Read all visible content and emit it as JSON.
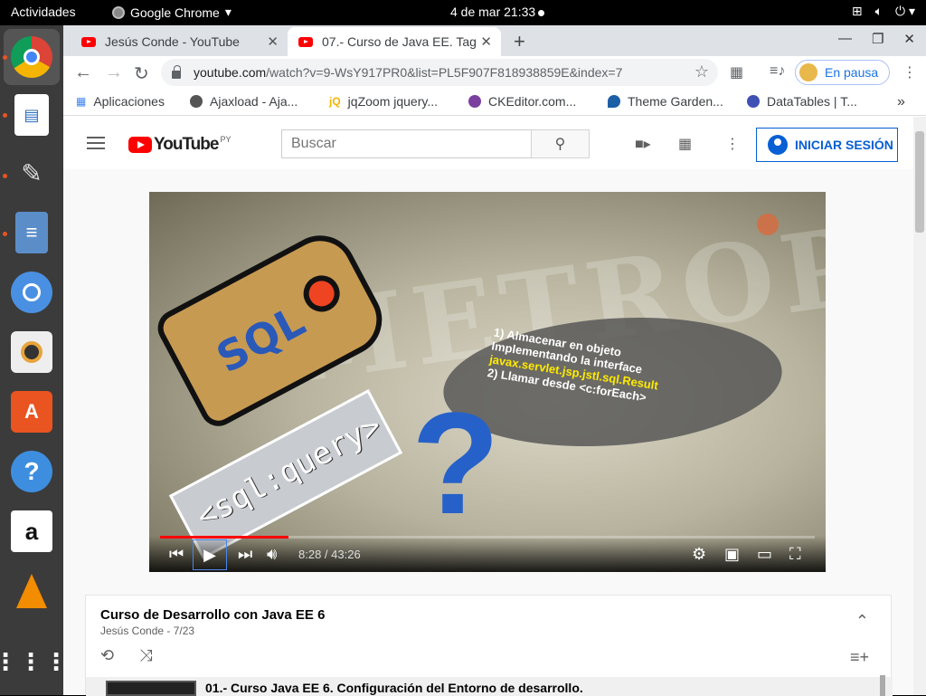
{
  "system": {
    "activities": "Actividades",
    "app_name": "Google Chrome",
    "clock": "4 de mar  21:33"
  },
  "tabs": [
    {
      "title": "Jesús Conde - YouTube",
      "active": false
    },
    {
      "title": "07.- Curso de Java EE. Tag",
      "active": true
    }
  ],
  "address_bar": {
    "host": "youtube.com",
    "path": "/watch?v=9-WsY917PR0&list=PL5F907F818938859E&index=7"
  },
  "profile": {
    "label": "En pausa"
  },
  "bookmarks": [
    {
      "label": "Aplicaciones",
      "color": "#4285f4"
    },
    {
      "label": "Ajaxload - Aja...",
      "color": "#555555"
    },
    {
      "label": "jqZoom jquery...",
      "color": "#f4b400"
    },
    {
      "label": "CKEditor.com...",
      "color": "#7b3fa0"
    },
    {
      "label": "Theme Garden...",
      "color": "#1c5fa6"
    },
    {
      "label": "DataTables | T...",
      "color": "#3f51b5"
    }
  ],
  "youtube": {
    "logo_text": "YouTube",
    "country": "PY",
    "search_placeholder": "Buscar",
    "signin_label": "INICIAR SESIÓN"
  },
  "video": {
    "slide_title": "METROPOLIS",
    "tag_text": "SQL",
    "bubble_lines": [
      "1) Almacenar en objeto",
      "Implementando la interface",
      "javax.servlet.jsp.jstl.sql.Result",
      "2) Llamar desde <c:forEach>"
    ],
    "sql_query_label": "<sql:query>",
    "time": "8:28 / 43:26",
    "progress_fraction": 0.196
  },
  "playlist": {
    "title": "Curso de Desarrollo con Java EE 6",
    "author": "Jesús Conde",
    "position": "7/23",
    "first_item": "01.- Curso Java EE 6. Configuración del Entorno de desarrollo."
  },
  "colors": {
    "accent_red": "#ff0000",
    "link_blue": "#065fd4",
    "dock_bg": "#3b3b3b",
    "ubuntu_orange": "#e95420"
  }
}
